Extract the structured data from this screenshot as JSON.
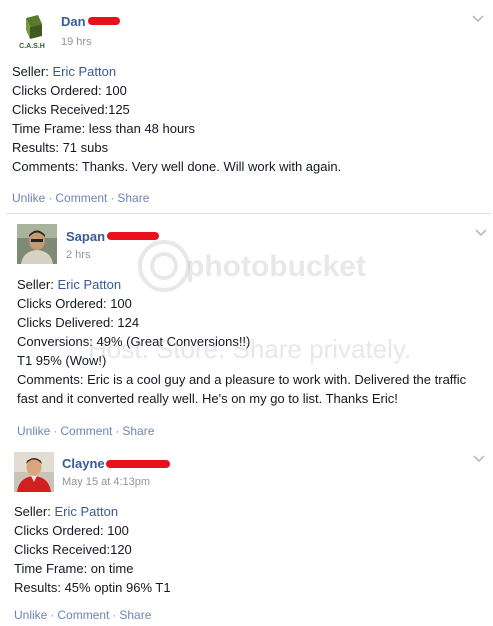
{
  "posts": [
    {
      "author": "Dan",
      "time": "19 hrs",
      "avatar_icon": "cash-logo-avatar",
      "seller_label": "Seller: ",
      "seller_name": "Eric Patton",
      "lines": [
        "Clicks Ordered: 100",
        "Clicks Received:125",
        "Time Frame: less than 48 hours",
        "Results: 71 subs",
        "Comments: Thanks. Very well done. Will work with again."
      ],
      "actions": {
        "unlike": "Unlike",
        "comment": "Comment",
        "share": "Share",
        "sep": "·"
      }
    },
    {
      "author": "Sapan",
      "time": "2 hrs",
      "avatar_icon": "person-photo-avatar",
      "seller_label": "Seller: ",
      "seller_name": "Eric Patton",
      "lines": [
        "Clicks Ordered: 100",
        "Clicks Delivered: 124",
        "Conversions: 49% (Great Conversions!!)",
        "T1 95% (Wow!)",
        "Comments: Eric is a cool guy and a pleasure to work with. Delivered the traffic fast and it converted really well. He's on my go to list. Thanks Eric!"
      ],
      "actions": {
        "unlike": "Unlike",
        "comment": "Comment",
        "share": "Share",
        "sep": "·"
      }
    },
    {
      "author": "Clayne",
      "time": "May 15 at 4:13pm",
      "avatar_icon": "person-photo-avatar",
      "seller_label": "Seller: ",
      "seller_name": "Eric Patton",
      "lines": [
        "Clicks Ordered: 100",
        "Clicks Received:120",
        "Time Frame: on time",
        "Results: 45% optin 96% T1"
      ],
      "actions": {
        "unlike": "Unlike",
        "comment": "Comment",
        "share": "Share",
        "sep": "·"
      }
    }
  ],
  "avatar_logo_text": "C.A.S.H",
  "watermark": {
    "brand": "photobucket",
    "slogan": "Host. Store. Share privately."
  },
  "colors": {
    "link": "#3b5998",
    "meta": "#90949c",
    "redaction": "#e8101a",
    "action": "#6d84b4"
  }
}
